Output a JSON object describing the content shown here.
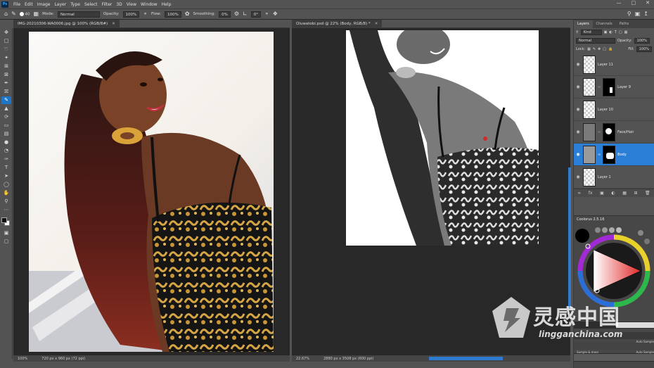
{
  "menubar": {
    "app_icon": "Ps",
    "items": [
      "File",
      "Edit",
      "Image",
      "Layer",
      "Type",
      "Select",
      "Filter",
      "3D",
      "View",
      "Window",
      "Help"
    ]
  },
  "options": {
    "brush_size": "40",
    "mode_label": "Mode:",
    "mode_value": "Normal",
    "opacity_label": "Opacity:",
    "opacity_value": "100%",
    "flow_label": "Flow:",
    "flow_value": "100%",
    "smoothing_label": "Smoothing:",
    "smoothing_value": "0%",
    "angle_value": "0°"
  },
  "doc_left": {
    "tab_title": "IMG-20210306-WA0006.jpg @ 100% (RGB/8#)",
    "status_zoom": "100%",
    "status_size": "720 px x 960 px (72 ppi)"
  },
  "doc_right": {
    "tab_title": "Oluwatobi.psd @ 22% (Body, RGB/8) *",
    "status_zoom": "22.67%",
    "status_size": "2880 px x 3508 px (600 ppi)"
  },
  "layers_panel": {
    "tabs": [
      "Layers",
      "Channels",
      "Paths"
    ],
    "kind_label": "Kind",
    "blend_mode": "Normal",
    "opacity_label": "Opacity:",
    "opacity_value": "100%",
    "lock_label": "Lock:",
    "fill_label": "Fill:",
    "fill_value": "100%",
    "layers": [
      {
        "name": "Layer 11",
        "has_mask": false,
        "selected": false
      },
      {
        "name": "Layer 9",
        "has_mask": true,
        "selected": false
      },
      {
        "name": "Layer 10",
        "has_mask": false,
        "selected": false
      },
      {
        "name": "Face/Hair",
        "has_mask": true,
        "selected": false
      },
      {
        "name": "Body",
        "has_mask": true,
        "selected": true
      },
      {
        "name": "Layer 1",
        "has_mask": false,
        "selected": false
      }
    ],
    "footer_icons": [
      "link-icon",
      "fx-icon",
      "mask-icon",
      "adjustment-icon",
      "group-icon",
      "new-layer-icon",
      "trash-icon"
    ]
  },
  "coolorus": {
    "title": "Coolorus 2.5.16",
    "labels": [
      "Auto Sample",
      "Sample & mass",
      "Auto Sample"
    ]
  },
  "watermark": {
    "title": "灵感中国",
    "url": "lingganchina.com"
  },
  "colors": {
    "accent": "#1d75c7",
    "panel": "#535353",
    "canvas_bg": "#282828"
  }
}
